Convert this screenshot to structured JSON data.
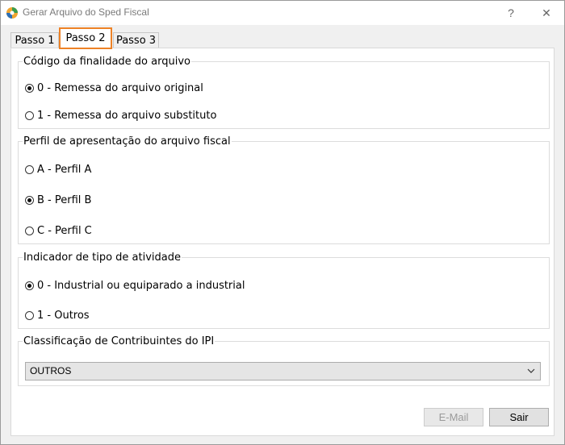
{
  "window": {
    "title": "Gerar Arquivo do Sped Fiscal",
    "help_label": "?",
    "close_label": "✕"
  },
  "tabs": [
    {
      "label": "Passo 1",
      "active": false
    },
    {
      "label": "Passo 2",
      "active": true
    },
    {
      "label": "Passo 3",
      "active": false
    }
  ],
  "finalidade": {
    "legend": "Código da finalidade do arquivo",
    "options": [
      {
        "label": "0 - Remessa do arquivo original",
        "checked": true
      },
      {
        "label": "1 - Remessa do arquivo substituto",
        "checked": false
      }
    ]
  },
  "perfil": {
    "legend": "Perfil de apresentação do arquivo fiscal",
    "options": [
      {
        "label": "A - Perfil A",
        "checked": false
      },
      {
        "label": "B - Perfil B",
        "checked": true
      },
      {
        "label": "C - Perfil C",
        "checked": false
      }
    ]
  },
  "atividade": {
    "legend": "Indicador de tipo de atividade",
    "options": [
      {
        "label": "0 - Industrial ou equiparado a industrial",
        "checked": true
      },
      {
        "label": "1 - Outros",
        "checked": false
      }
    ]
  },
  "classificacao": {
    "legend": "Classificação de Contribuintes do IPI",
    "selected": "OUTROS"
  },
  "buttons": {
    "email": "E-Mail",
    "exit": "Sair"
  },
  "colors": {
    "active_tab_border": "#ee8226",
    "disabled_text": "#9a9a9a"
  }
}
